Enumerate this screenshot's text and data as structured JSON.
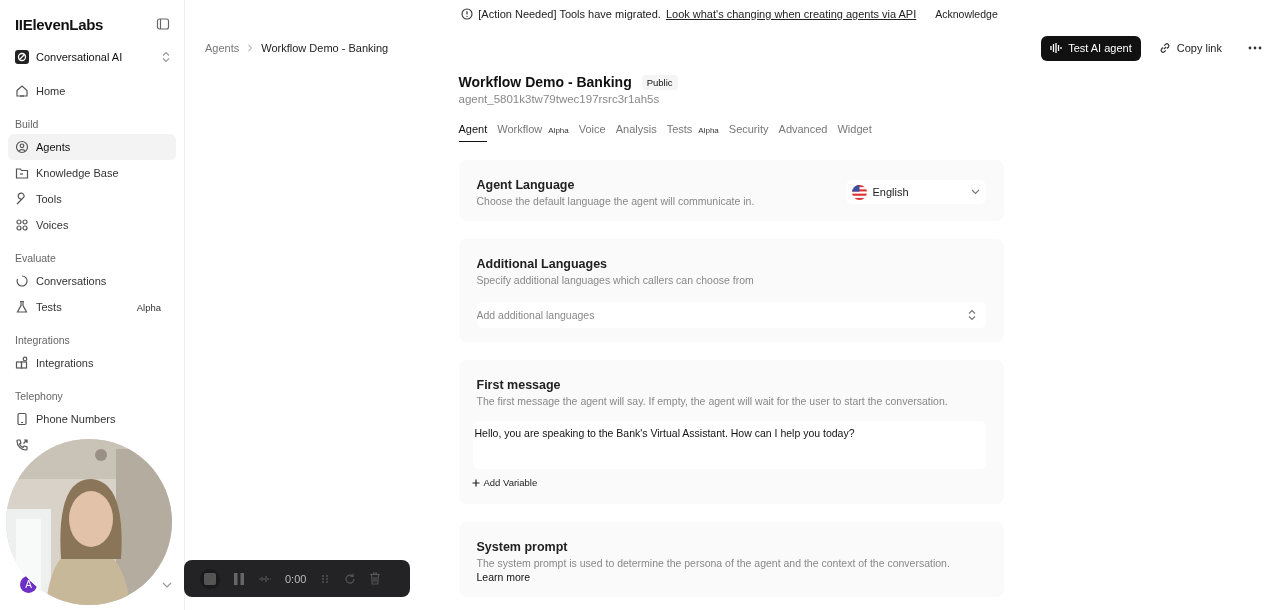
{
  "sidebar": {
    "logo": "IIElevenLabs",
    "workspace": "Conversational AI",
    "sections": [
      {
        "items": [
          {
            "label": "Home",
            "selected": false
          }
        ]
      },
      {
        "heading": "Build",
        "items": [
          {
            "label": "Agents",
            "selected": true
          },
          {
            "label": "Knowledge Base",
            "selected": false
          },
          {
            "label": "Tools",
            "selected": false
          },
          {
            "label": "Voices",
            "selected": false
          }
        ]
      },
      {
        "heading": "Evaluate",
        "items": [
          {
            "label": "Conversations",
            "selected": false
          },
          {
            "label": "Tests",
            "selected": false,
            "badge": "Alpha"
          }
        ]
      },
      {
        "heading": "Integrations",
        "items": [
          {
            "label": "Integrations",
            "selected": false
          }
        ]
      },
      {
        "heading": "Telephony",
        "items": [
          {
            "label": "Phone Numbers",
            "selected": false
          }
        ]
      }
    ],
    "avatar": "A"
  },
  "banner": {
    "text": "[Action Needed] Tools have migrated.",
    "link": "Look what's changing when creating agents via API",
    "button": "Acknowledge"
  },
  "breadcrumb": [
    "Agents",
    "Workflow Demo - Banking"
  ],
  "actions": {
    "primary": "Test AI agent",
    "secondary": "Copy link"
  },
  "agent": {
    "name": "Workflow Demo - Banking",
    "visibility": "Public",
    "id": "agent_5801k3tw79twec197rsrc3r1ah5s"
  },
  "tabs": [
    {
      "label": "Agent",
      "selected": true
    },
    {
      "label": "Workflow",
      "selected": false,
      "badge": "Alpha"
    },
    {
      "label": "Voice",
      "selected": false
    },
    {
      "label": "Analysis",
      "selected": false
    },
    {
      "label": "Tests",
      "selected": false,
      "badge": "Alpha"
    },
    {
      "label": "Security",
      "selected": false
    },
    {
      "label": "Advanced",
      "selected": false
    },
    {
      "label": "Widget",
      "selected": false
    }
  ],
  "cards": [
    {
      "kind": "select",
      "title": "Agent Language",
      "description": "Choose the default language the agent will communicate in.",
      "value": "English"
    },
    {
      "kind": "multiselect",
      "title": "Additional Languages",
      "description": "Specify additional languages which callers can choose from",
      "placeholder": "Add additional languages"
    },
    {
      "kind": "textarea",
      "title": "First message",
      "description": "The first message the agent will say. If empty, the agent will wait for the user to start the conversation.",
      "value": "Hello, you are speaking to the Bank's Virtual Assistant. How can I help you today?",
      "button": "Add Variable"
    },
    {
      "kind": "prompt",
      "title": "System prompt",
      "description": "The system prompt is used to determine the persona of the agent and the context of the conversation.",
      "link": "Learn more"
    }
  ],
  "recorder": {
    "time": "0:00"
  }
}
